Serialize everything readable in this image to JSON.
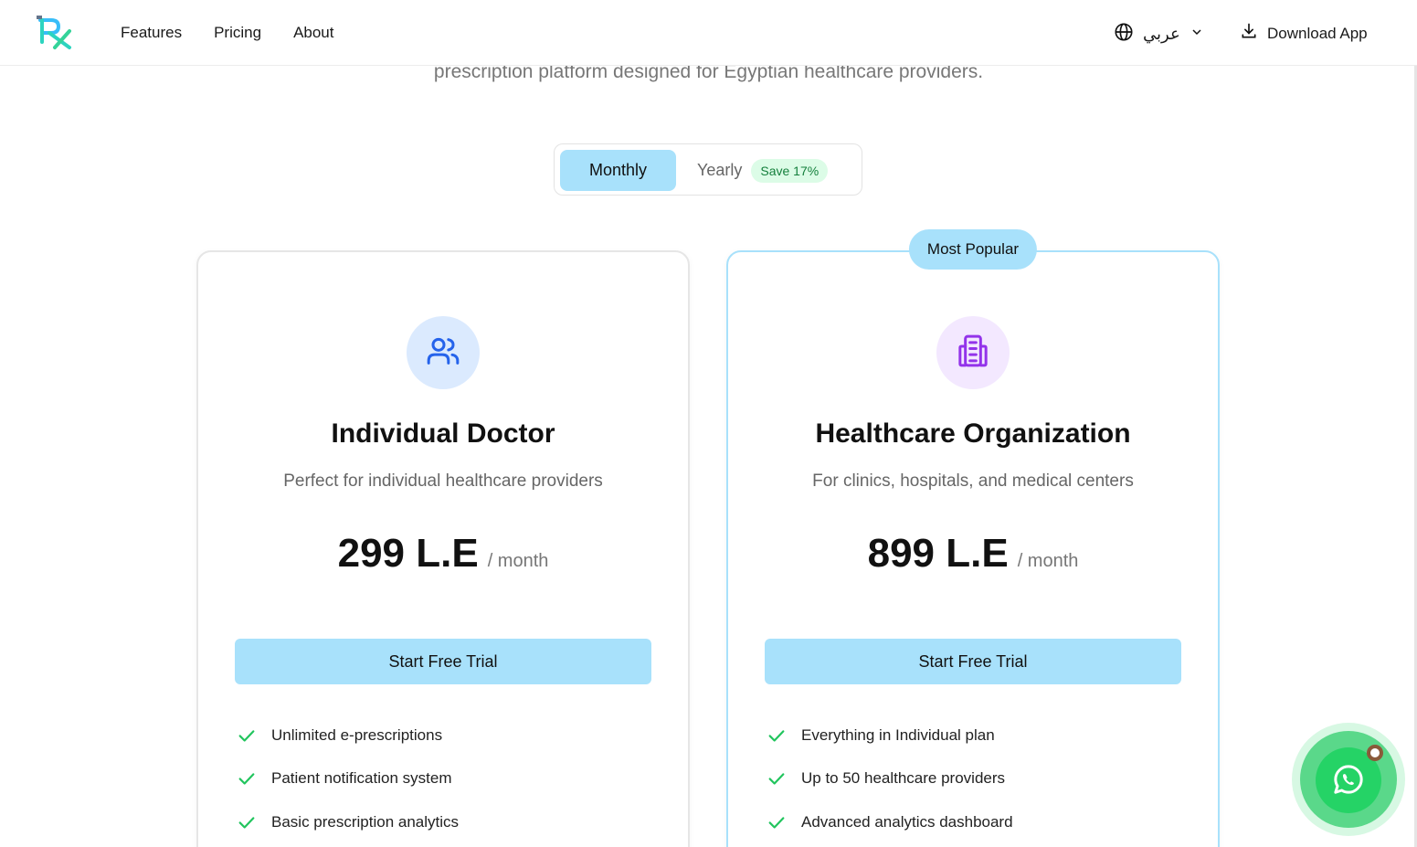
{
  "header": {
    "nav": [
      {
        "label": "Features"
      },
      {
        "label": "Pricing"
      },
      {
        "label": "About"
      }
    ],
    "language_label": "عربي",
    "download_label": "Download App"
  },
  "hero": {
    "subtitle": "prescription platform designed for Egyptian healthcare providers."
  },
  "billing_toggle": {
    "monthly_label": "Monthly",
    "yearly_label": "Yearly",
    "save_badge": "Save 17%",
    "selected": "Monthly"
  },
  "plans": [
    {
      "icon": "users-icon",
      "title": "Individual Doctor",
      "description": "Perfect for individual healthcare providers",
      "price": "299 L.E",
      "period": "/ month",
      "cta_label": "Start Free Trial",
      "features": [
        "Unlimited e-prescriptions",
        "Patient notification system",
        "Basic prescription analytics"
      ]
    },
    {
      "icon": "building-icon",
      "badge": "Most Popular",
      "title": "Healthcare Organization",
      "description": "For clinics, hospitals, and medical centers",
      "price": "899 L.E",
      "period": "/ month",
      "cta_label": "Start Free Trial",
      "features": [
        "Everything in Individual plan",
        "Up to 50 healthcare providers",
        "Advanced analytics dashboard"
      ]
    }
  ],
  "colors": {
    "accent": "#a8e1fb",
    "check": "#22c55e",
    "whatsapp": "#25d366",
    "blue_icon": "#2563eb",
    "purple_icon": "#9333ea"
  }
}
